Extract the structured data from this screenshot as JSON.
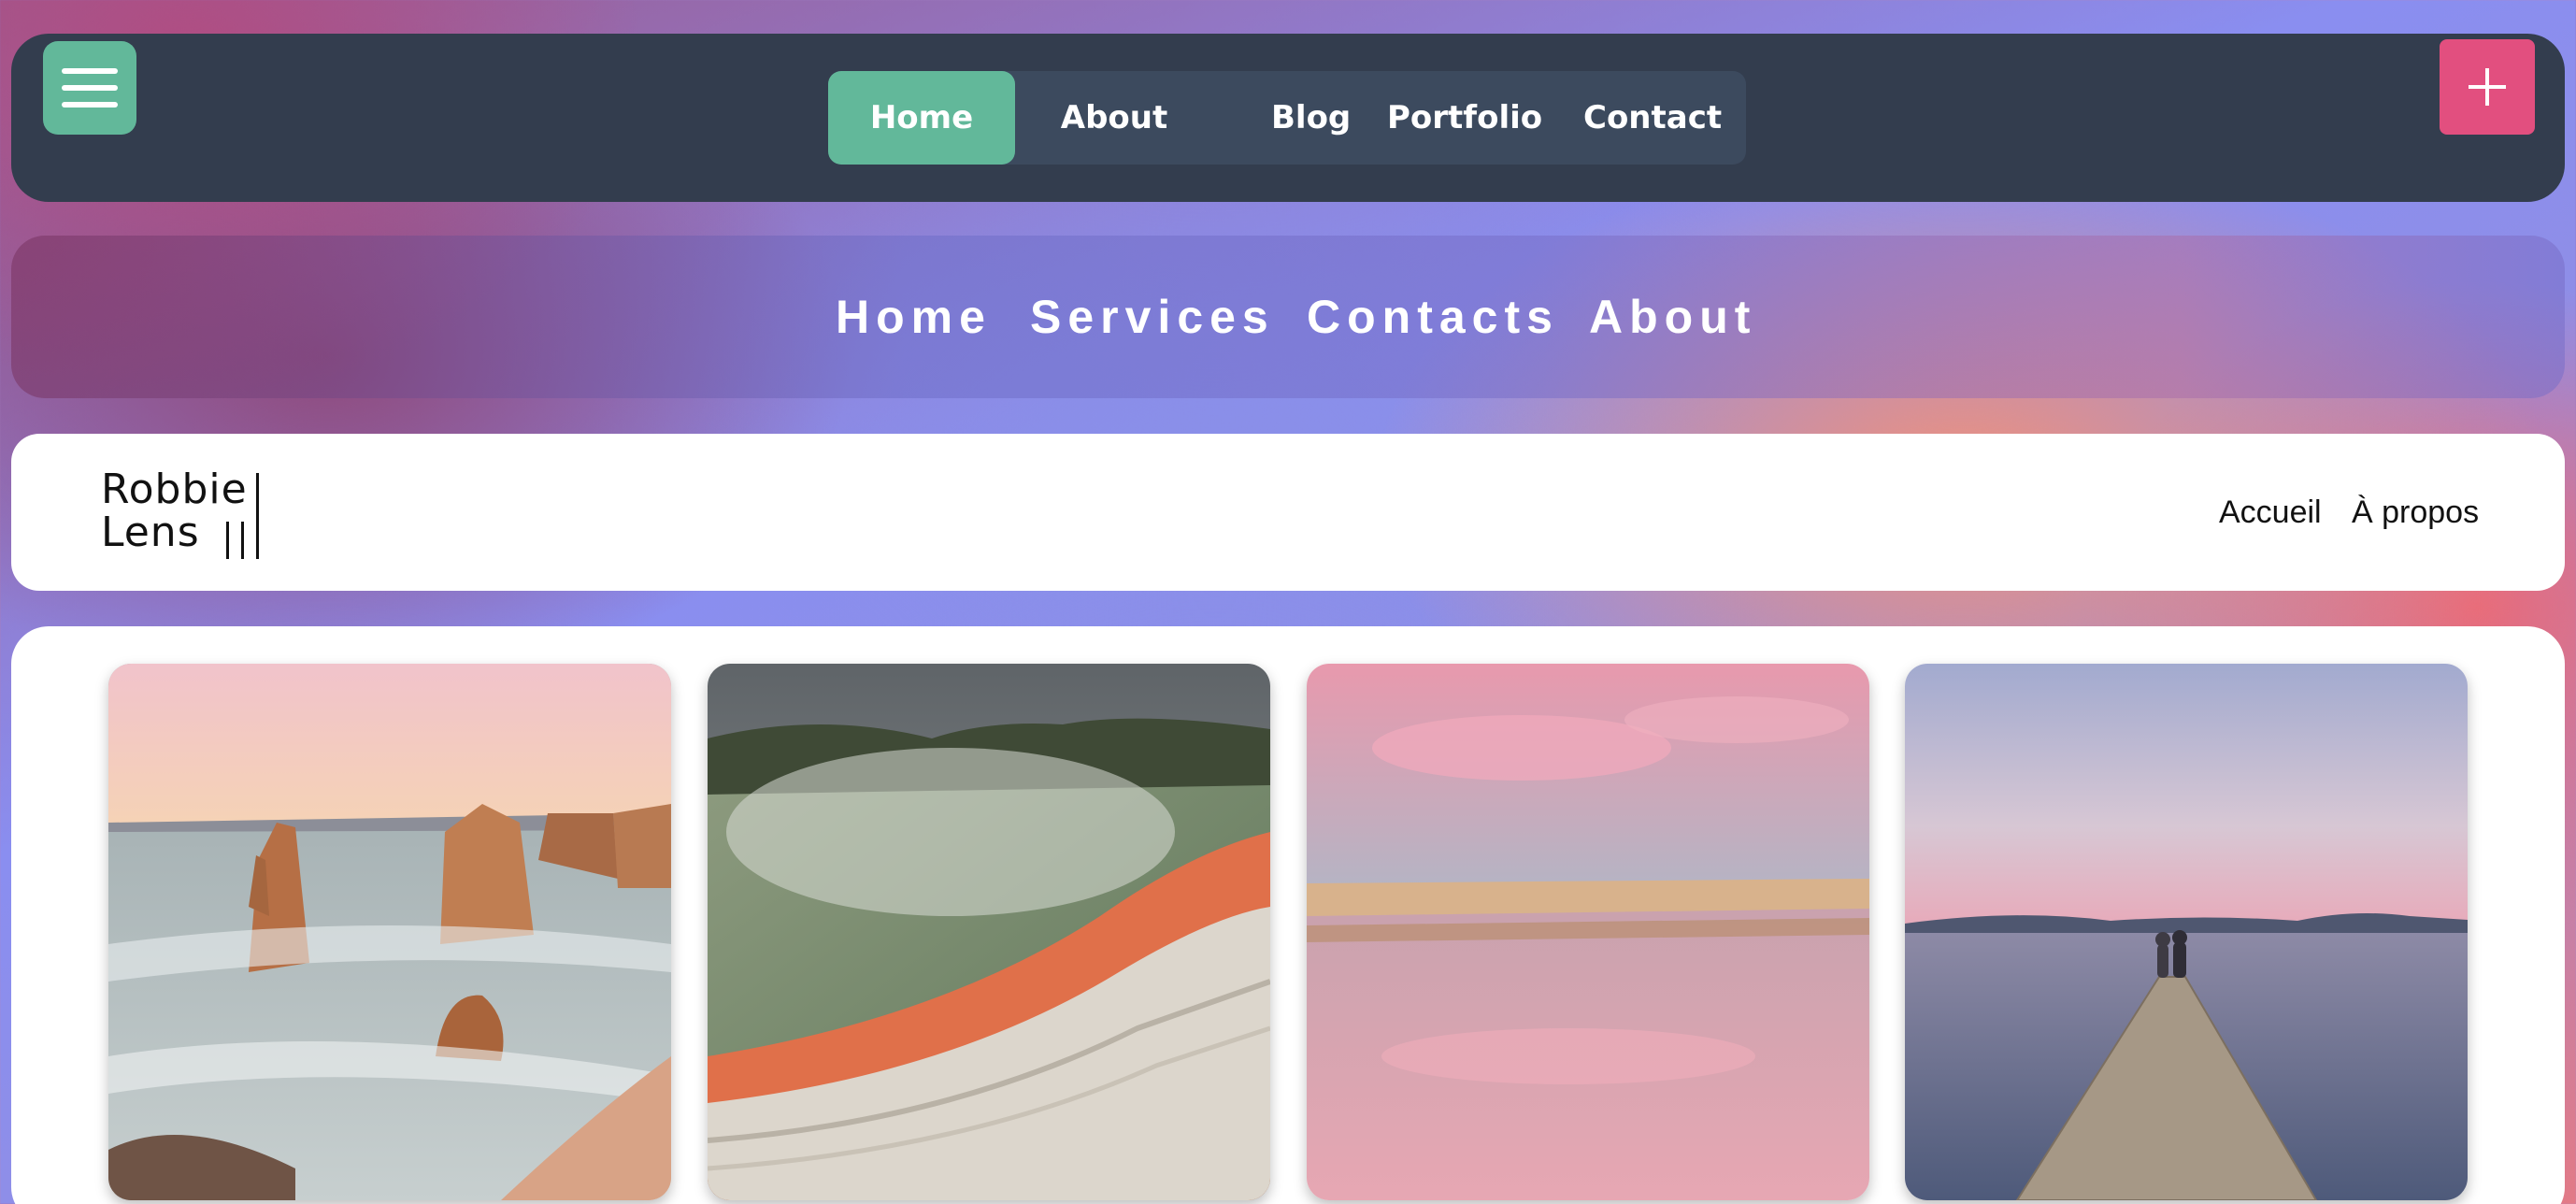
{
  "top_nav": {
    "items": [
      {
        "label": "Home",
        "active": true
      },
      {
        "label": "About",
        "active": false
      },
      {
        "label": "Blog",
        "active": false
      },
      {
        "label": "Portfolio",
        "active": false
      },
      {
        "label": "Contact",
        "active": false
      }
    ],
    "menu_icon": "hamburger-icon",
    "add_icon": "plus-icon",
    "colors": {
      "bar": "#333d4e",
      "pill": "#3c4a5e",
      "active": "#62b89a",
      "add_button": "#e24f7f"
    }
  },
  "glass_nav": {
    "items": [
      {
        "label": "Home"
      },
      {
        "label": "Services"
      },
      {
        "label": "Contacts"
      },
      {
        "label": "About"
      }
    ]
  },
  "header": {
    "logo_line1": "Robbie",
    "logo_line2": "Lens",
    "links": [
      {
        "label": "Accueil"
      },
      {
        "label": "À propos"
      }
    ]
  },
  "gallery": {
    "photos": [
      {
        "subject": "coastal limestone sea stacks at sunset"
      },
      {
        "subject": "steaming geothermal hot spring pool"
      },
      {
        "subject": "calm pink reflection lagoon"
      },
      {
        "subject": "couple sitting at end of wooden pier at dusk"
      }
    ]
  }
}
